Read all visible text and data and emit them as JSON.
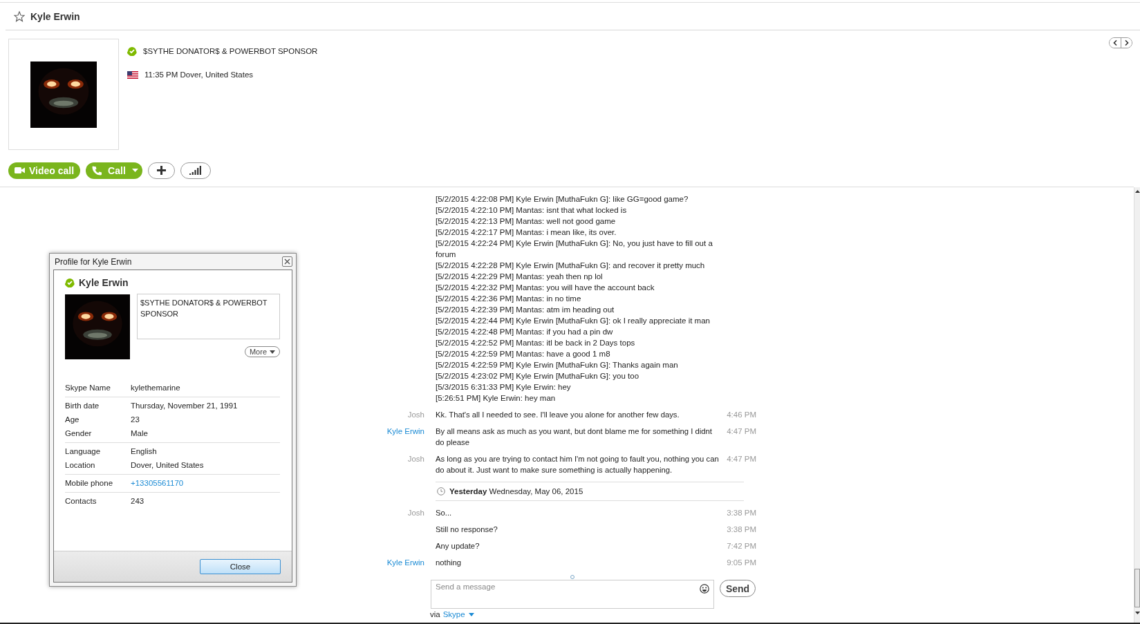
{
  "header": {
    "name": "Kyle Erwin",
    "favorite": false
  },
  "profile": {
    "online": true,
    "mood": "$SYTHE DONATOR$ & POWERBOT SPONSOR",
    "local_time": "11:35 PM Dover, United States"
  },
  "actions": [
    {
      "kind": "video",
      "label": "Video call"
    },
    {
      "kind": "call",
      "label": "Call"
    },
    {
      "kind": "add"
    },
    {
      "kind": "quality"
    }
  ],
  "chat": {
    "log": [
      "[5/2/2015 4:22:08 PM] Kyle Erwin [MuthaFukn G]: like GG=good game?",
      "[5/2/2015 4:22:10 PM] Mantas: isnt that what locked is",
      "[5/2/2015 4:22:13 PM] Mantas: well not good game",
      "[5/2/2015 4:22:17 PM] Mantas: i mean like, its over.",
      "[5/2/2015 4:22:24 PM] Kyle Erwin [MuthaFukn G]: No, you just have to fill out a forum",
      "[5/2/2015 4:22:28 PM] Kyle Erwin [MuthaFukn G]: and recover it pretty much",
      "[5/2/2015 4:22:29 PM] Mantas: yeah then np lol",
      "[5/2/2015 4:22:32 PM] Mantas: you will have the account back",
      "[5/2/2015 4:22:36 PM] Mantas: in no time",
      "[5/2/2015 4:22:39 PM] Mantas: atm im heading out",
      "[5/2/2015 4:22:44 PM] Kyle Erwin [MuthaFukn G]: ok I really appreciate it man",
      "[5/2/2015 4:22:48 PM] Mantas: if you had a pin dw",
      "[5/2/2015 4:22:52 PM] Mantas: itl be back in 2 Days tops",
      "[5/2/2015 4:22:59 PM] Mantas: have a good 1 m8",
      "[5/2/2015 4:22:59 PM] Kyle Erwin [MuthaFukn G]: Thanks again man",
      "[5/2/2015 4:23:02 PM] Kyle Erwin [MuthaFukn G]: you too",
      "[5/3/2015 6:31:33 PM] Kyle Erwin: hey",
      "[5:26:51 PM] Kyle Erwin: hey man"
    ],
    "messages": [
      {
        "kind": "message",
        "sender": "Josh",
        "color": "#999999",
        "text": "Kk. That's all I needed to see. I'll leave you alone for another few days.",
        "time": "4:46 PM"
      },
      {
        "kind": "message",
        "sender": "Kyle Erwin",
        "color": "#1a8ad4",
        "text": "By all means ask as much as you want, but dont blame me for something I didnt do please",
        "time": "4:47 PM"
      },
      {
        "kind": "message",
        "sender": "Josh",
        "color": "#999999",
        "text": "As long as you are trying to contact him I'm not going to fault you, nothing you can do about it. Just want to make sure something is actually happening.",
        "time": "4:47 PM"
      },
      {
        "kind": "date",
        "date": "**Yesterday** Wednesday, May 06, 2015"
      },
      {
        "kind": "message",
        "sender": "Josh",
        "color": "#999999",
        "text": "So...",
        "time": "3:38 PM"
      },
      {
        "kind": "message",
        "text": "Still no response?",
        "time": "3:38 PM"
      },
      {
        "kind": "message",
        "text": "Any update?",
        "time": "7:42 PM"
      },
      {
        "kind": "message",
        "sender": "Kyle Erwin",
        "color": "#1a8ad4",
        "text": "nothing",
        "time": "9:05 PM"
      }
    ]
  },
  "composer": {
    "placeholder": "Send a message",
    "send": "Send",
    "via": "via",
    "channel": "Skype"
  },
  "dialog": {
    "title": "Profile for Kyle Erwin",
    "name": "Kyle Erwin",
    "online": true,
    "mood": "$SYTHE DONATOR$ & POWERBOT SPONSOR",
    "more": "More",
    "close": "Close",
    "groups": [
      [
        {
          "label": "Skype Name",
          "value": "kylethemarine",
          "kind": "text"
        }
      ],
      [
        {
          "label": "Birth date",
          "value": "Thursday, November 21, 1991",
          "kind": "text"
        },
        {
          "label": "Age",
          "value": "23",
          "kind": "text"
        },
        {
          "label": "Gender",
          "value": "Male",
          "kind": "text"
        }
      ],
      [
        {
          "label": "Language",
          "value": "English",
          "kind": "text"
        },
        {
          "label": "Location",
          "value": "Dover, United States",
          "kind": "text"
        }
      ],
      [
        {
          "label": "Mobile phone",
          "value": "+13305561170",
          "kind": "link"
        }
      ],
      [
        {
          "label": "Contacts",
          "value": "243",
          "kind": "text"
        }
      ]
    ]
  }
}
